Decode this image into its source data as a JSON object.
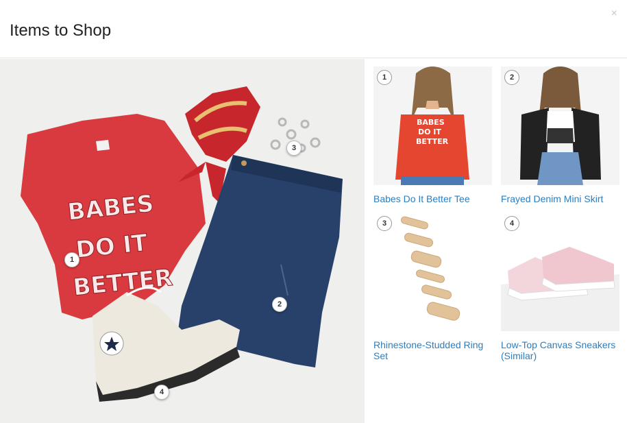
{
  "header": {
    "title": "Items to Shop",
    "close_icon": "×"
  },
  "main_photo": {
    "pins": [
      {
        "number": "1"
      },
      {
        "number": "2"
      },
      {
        "number": "3"
      },
      {
        "number": "4"
      }
    ],
    "tee_text": [
      "BABES",
      "DO IT",
      "BETTER"
    ]
  },
  "products": [
    {
      "number": "1",
      "name": "Babes Do It Better Tee",
      "thumb_text": [
        "BABES",
        "DO IT",
        "BETTER"
      ]
    },
    {
      "number": "2",
      "name": "Frayed Denim Mini Skirt"
    },
    {
      "number": "3",
      "name": "Rhinestone-Studded Ring Set"
    },
    {
      "number": "4",
      "name": "Low-Top Canvas Sneakers (Similar)"
    }
  ],
  "colors": {
    "link": "#2a7ec1",
    "tee_red": "#d93a3f",
    "denim": "#27416b",
    "background": "#efefed"
  }
}
